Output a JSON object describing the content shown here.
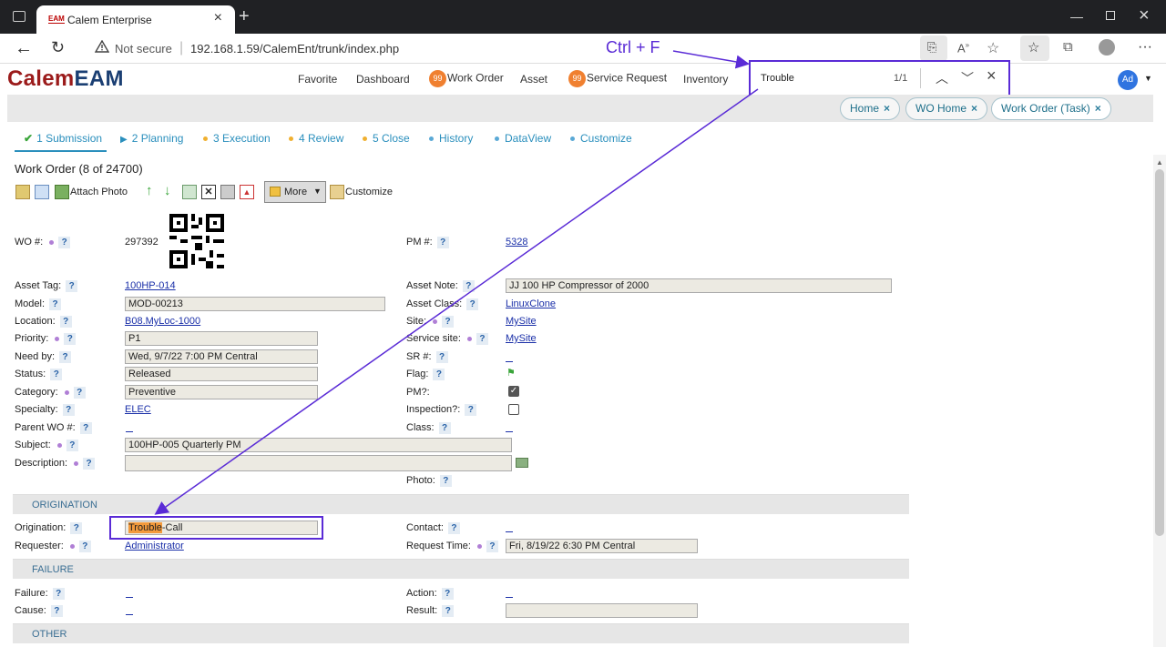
{
  "browser": {
    "tab_title": "Calem Enterprise",
    "tab_favicon": "EAM",
    "not_secure": "Not secure",
    "url": "192.168.1.59/CalemEnt/trunk/index.php"
  },
  "annotation": {
    "shortcut": "Ctrl + F"
  },
  "find": {
    "query": "Trouble",
    "count": "1/1"
  },
  "app": {
    "logo_a": "Calem",
    "logo_b": "EAM",
    "menu": [
      "Favorite",
      "Dashboard",
      "Work Order",
      "Asset",
      "Service Request",
      "Inventory"
    ],
    "badge_wo": "99",
    "badge_sr": "99",
    "avatar": "Ad"
  },
  "crumbs": [
    "Home",
    "WO Home",
    "Work Order (Task)"
  ],
  "steps": [
    "1 Submission",
    "2 Planning",
    "3 Execution",
    "4 Review",
    "5 Close",
    "History",
    "DataView",
    "Customize"
  ],
  "page": {
    "title": "Work Order (8 of 24700)",
    "attach_photo": "Attach Photo",
    "more": "More",
    "customize": "Customize"
  },
  "form": {
    "wo_label": "WO #:",
    "wo_value": "297392",
    "pm_label": "PM #:",
    "pm_value": "5328",
    "asset_tag_label": "Asset Tag:",
    "asset_tag": "100HP-014",
    "asset_note_label": "Asset Note:",
    "asset_note": "JJ 100 HP Compressor of 2000",
    "model_label": "Model:",
    "model": "MOD-00213",
    "asset_class_label": "Asset Class:",
    "asset_class": "LinuxClone",
    "location_label": "Location:",
    "location": "B08.MyLoc-1000",
    "site_label": "Site:",
    "site": "MySite",
    "priority_label": "Priority:",
    "priority": "P1",
    "service_site_label": "Service site:",
    "service_site": "MySite",
    "need_by_label": "Need by:",
    "need_by": "Wed, 9/7/22 7:00 PM Central",
    "sr_label": "SR #:",
    "status_label": "Status:",
    "status": "Released",
    "flag_label": "Flag:",
    "category_label": "Category:",
    "category": "Preventive",
    "pm_q_label": "PM?:",
    "specialty_label": "Specialty:",
    "specialty": "ELEC",
    "inspection_label": "Inspection?:",
    "parent_wo_label": "Parent WO #:",
    "class_label": "Class:",
    "subject_label": "Subject:",
    "subject": "100HP-005 Quarterly PM",
    "description_label": "Description:",
    "photo_label": "Photo:"
  },
  "origination": {
    "section": "ORIGINATION",
    "origination_label": "Origination:",
    "origination_hl": "Trouble",
    "origination_rest": "-Call",
    "contact_label": "Contact:",
    "requester_label": "Requester:",
    "requester": "Administrator",
    "request_time_label": "Request Time:",
    "request_time": "Fri, 8/19/22 6:30 PM Central"
  },
  "failure": {
    "section": "FAILURE",
    "failure_label": "Failure:",
    "action_label": "Action:",
    "cause_label": "Cause:",
    "result_label": "Result:"
  },
  "other": {
    "section": "OTHER"
  },
  "colors": {
    "accent": "#2a8fbd",
    "annotation": "#5a2bd6",
    "highlight": "#f39a3c",
    "badge": "#f08030"
  }
}
